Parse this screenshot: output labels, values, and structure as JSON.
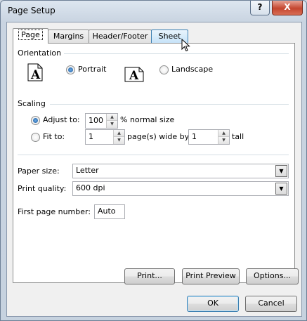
{
  "window": {
    "title": "Page Setup",
    "help_glyph": "?",
    "close_glyph": "X"
  },
  "tabs": [
    {
      "label": "Page",
      "active": true
    },
    {
      "label": "Margins",
      "active": false
    },
    {
      "label": "Header/Footer",
      "active": false
    },
    {
      "label": "Sheet",
      "active": false,
      "hovered": true
    }
  ],
  "orientation": {
    "title": "Orientation",
    "portrait_label": "Portrait",
    "landscape_label": "Landscape",
    "selected": "Portrait",
    "icon_letter": "A"
  },
  "scaling": {
    "title": "Scaling",
    "adjust_label": "Adjust to:",
    "adjust_value": "100",
    "adjust_suffix": "% normal size",
    "fit_label": "Fit to:",
    "fit_wide_value": "1",
    "fit_wide_suffix": "page(s) wide by",
    "fit_tall_value": "1",
    "fit_tall_suffix": "tall",
    "selected": "Adjust to:"
  },
  "paper": {
    "size_label": "Paper size:",
    "size_value": "Letter",
    "quality_label": "Print quality:",
    "quality_value": "600 dpi",
    "first_page_label": "First page number:",
    "first_page_value": "Auto"
  },
  "buttons": {
    "print": "Print...",
    "preview": "Print Preview",
    "options": "Options...",
    "ok": "OK",
    "cancel": "Cancel"
  }
}
